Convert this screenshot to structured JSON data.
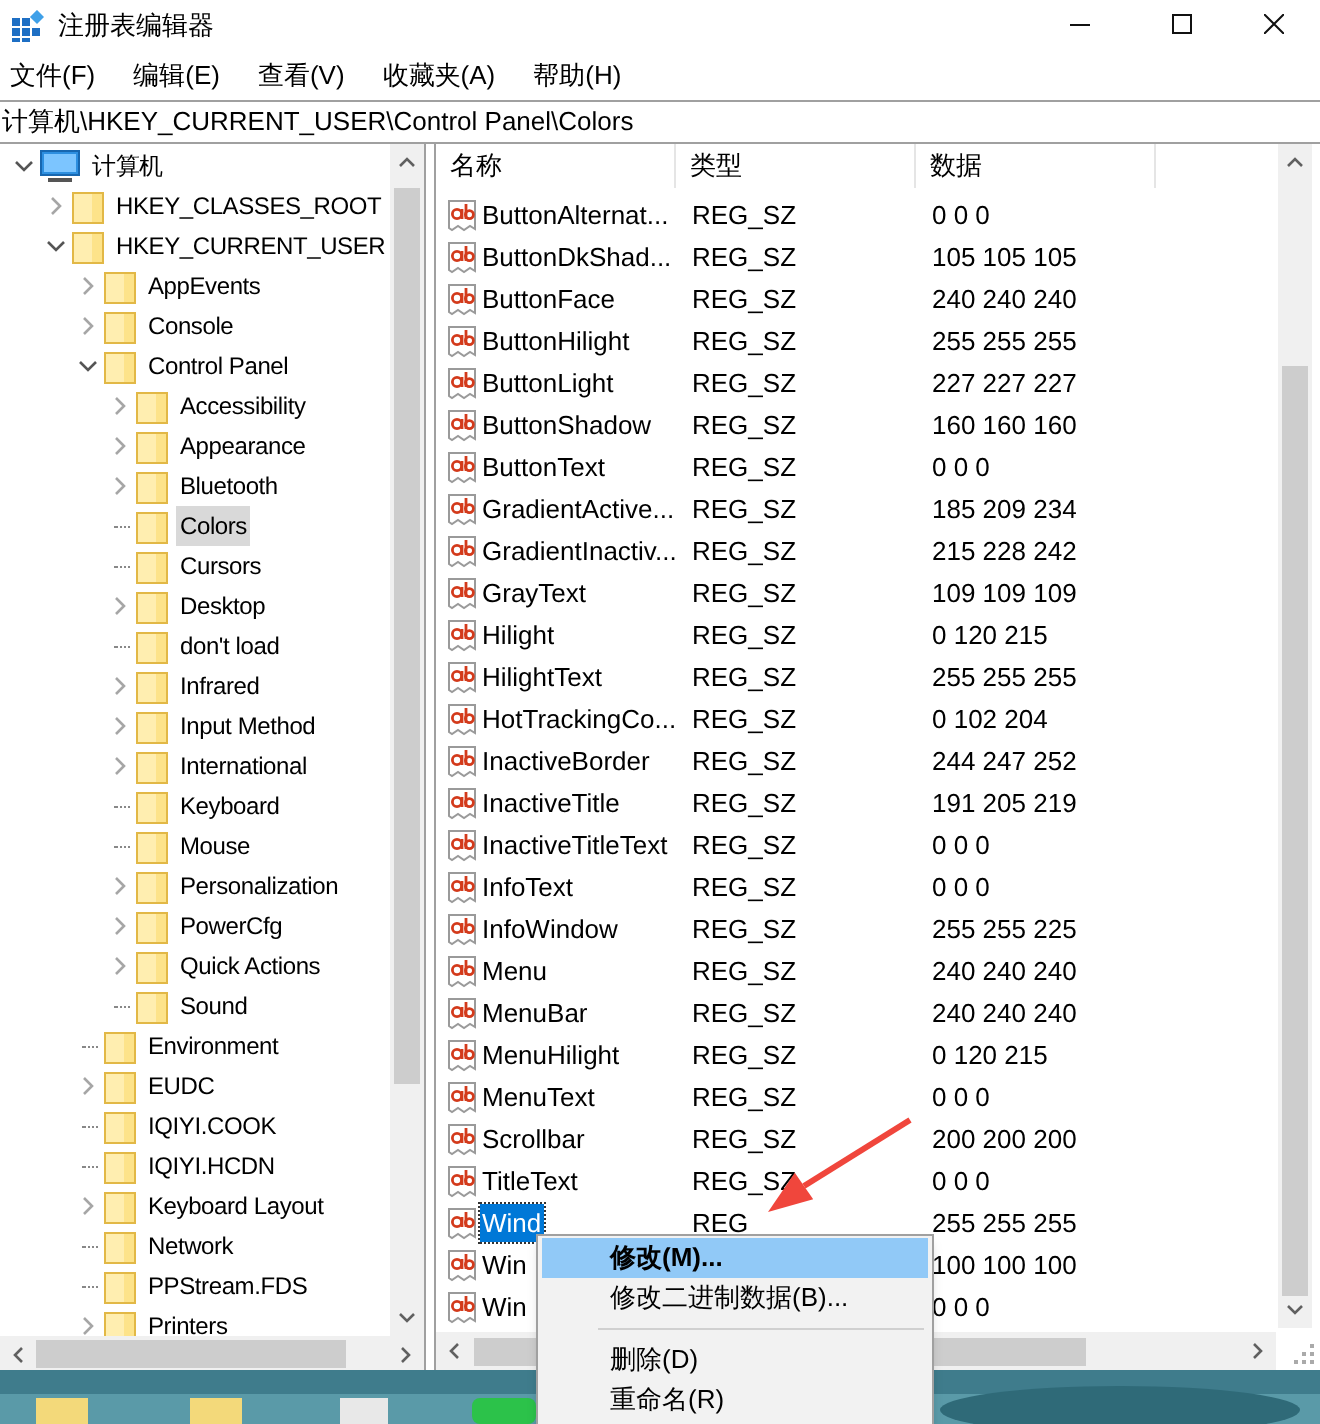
{
  "window": {
    "title": "注册表编辑器"
  },
  "menu_bar": [
    "文件(F)",
    "编辑(E)",
    "查看(V)",
    "收藏夹(A)",
    "帮助(H)"
  ],
  "address_bar": "计算机\\HKEY_CURRENT_USER\\Control Panel\\Colors",
  "tree": [
    {
      "label": "计算机",
      "kind": "computer",
      "has_children": true,
      "expanded": true,
      "selected": false,
      "children": [
        {
          "label": "HKEY_CLASSES_ROOT",
          "has_children": true,
          "expanded": false,
          "selected": false
        },
        {
          "label": "HKEY_CURRENT_USER",
          "has_children": true,
          "expanded": true,
          "selected": false,
          "children": [
            {
              "label": "AppEvents",
              "has_children": true,
              "expanded": false,
              "selected": false
            },
            {
              "label": "Console",
              "has_children": true,
              "expanded": false,
              "selected": false
            },
            {
              "label": "Control Panel",
              "has_children": true,
              "expanded": true,
              "selected": false,
              "children": [
                {
                  "label": "Accessibility",
                  "has_children": true,
                  "expanded": false,
                  "selected": false
                },
                {
                  "label": "Appearance",
                  "has_children": true,
                  "expanded": false,
                  "selected": false
                },
                {
                  "label": "Bluetooth",
                  "has_children": true,
                  "expanded": false,
                  "selected": false
                },
                {
                  "label": "Colors",
                  "has_children": false,
                  "selected": true
                },
                {
                  "label": "Cursors",
                  "has_children": false,
                  "selected": false
                },
                {
                  "label": "Desktop",
                  "has_children": true,
                  "expanded": false,
                  "selected": false
                },
                {
                  "label": "don't load",
                  "has_children": false,
                  "selected": false
                },
                {
                  "label": "Infrared",
                  "has_children": true,
                  "expanded": false,
                  "selected": false
                },
                {
                  "label": "Input Method",
                  "has_children": true,
                  "expanded": false,
                  "selected": false
                },
                {
                  "label": "International",
                  "has_children": true,
                  "expanded": false,
                  "selected": false
                },
                {
                  "label": "Keyboard",
                  "has_children": false,
                  "selected": false
                },
                {
                  "label": "Mouse",
                  "has_children": false,
                  "selected": false
                },
                {
                  "label": "Personalization",
                  "has_children": true,
                  "expanded": false,
                  "selected": false
                },
                {
                  "label": "PowerCfg",
                  "has_children": true,
                  "expanded": false,
                  "selected": false
                },
                {
                  "label": "Quick Actions",
                  "has_children": true,
                  "expanded": false,
                  "selected": false
                },
                {
                  "label": "Sound",
                  "has_children": false,
                  "selected": false
                }
              ]
            },
            {
              "label": "Environment",
              "has_children": false,
              "selected": false
            },
            {
              "label": "EUDC",
              "has_children": true,
              "expanded": false,
              "selected": false
            },
            {
              "label": "IQIYI.COOK",
              "has_children": false,
              "selected": false
            },
            {
              "label": "IQIYI.HCDN",
              "has_children": false,
              "selected": false
            },
            {
              "label": "Keyboard Layout",
              "has_children": true,
              "expanded": false,
              "selected": false
            },
            {
              "label": "Network",
              "has_children": false,
              "selected": false
            },
            {
              "label": "PPStream.FDS",
              "has_children": false,
              "selected": false
            },
            {
              "label": "Printers",
              "has_children": true,
              "expanded": false,
              "selected": false
            }
          ]
        }
      ]
    }
  ],
  "table": {
    "columns": [
      "名称",
      "类型",
      "数据"
    ],
    "rows": [
      {
        "name": "ButtonAlternat...",
        "type": "REG_SZ",
        "data": "0 0 0",
        "selected": false
      },
      {
        "name": "ButtonDkShad...",
        "type": "REG_SZ",
        "data": "105 105 105",
        "selected": false
      },
      {
        "name": "ButtonFace",
        "type": "REG_SZ",
        "data": "240 240 240",
        "selected": false
      },
      {
        "name": "ButtonHilight",
        "type": "REG_SZ",
        "data": "255 255 255",
        "selected": false
      },
      {
        "name": "ButtonLight",
        "type": "REG_SZ",
        "data": "227 227 227",
        "selected": false
      },
      {
        "name": "ButtonShadow",
        "type": "REG_SZ",
        "data": "160 160 160",
        "selected": false
      },
      {
        "name": "ButtonText",
        "type": "REG_SZ",
        "data": "0 0 0",
        "selected": false
      },
      {
        "name": "GradientActive...",
        "type": "REG_SZ",
        "data": "185 209 234",
        "selected": false
      },
      {
        "name": "GradientInactiv...",
        "type": "REG_SZ",
        "data": "215 228 242",
        "selected": false
      },
      {
        "name": "GrayText",
        "type": "REG_SZ",
        "data": "109 109 109",
        "selected": false
      },
      {
        "name": "Hilight",
        "type": "REG_SZ",
        "data": "0 120 215",
        "selected": false
      },
      {
        "name": "HilightText",
        "type": "REG_SZ",
        "data": "255 255 255",
        "selected": false
      },
      {
        "name": "HotTrackingCo...",
        "type": "REG_SZ",
        "data": "0 102 204",
        "selected": false
      },
      {
        "name": "InactiveBorder",
        "type": "REG_SZ",
        "data": "244 247 252",
        "selected": false
      },
      {
        "name": "InactiveTitle",
        "type": "REG_SZ",
        "data": "191 205 219",
        "selected": false
      },
      {
        "name": "InactiveTitleText",
        "type": "REG_SZ",
        "data": "0 0 0",
        "selected": false
      },
      {
        "name": "InfoText",
        "type": "REG_SZ",
        "data": "0 0 0",
        "selected": false
      },
      {
        "name": "InfoWindow",
        "type": "REG_SZ",
        "data": "255 255 225",
        "selected": false
      },
      {
        "name": "Menu",
        "type": "REG_SZ",
        "data": "240 240 240",
        "selected": false
      },
      {
        "name": "MenuBar",
        "type": "REG_SZ",
        "data": "240 240 240",
        "selected": false
      },
      {
        "name": "MenuHilight",
        "type": "REG_SZ",
        "data": "0 120 215",
        "selected": false
      },
      {
        "name": "MenuText",
        "type": "REG_SZ",
        "data": "0 0 0",
        "selected": false
      },
      {
        "name": "Scrollbar",
        "type": "REG_SZ",
        "data": "200 200 200",
        "selected": false
      },
      {
        "name": "TitleText",
        "type": "REG_SZ",
        "data": "0 0 0",
        "selected": false
      },
      {
        "name": "Wind",
        "type": "REG",
        "data": "255 255 255",
        "selected": true
      },
      {
        "name": "Win",
        "data": "100 100 100",
        "selected": false
      },
      {
        "name": "Win",
        "data": "0 0 0",
        "selected": false
      }
    ]
  },
  "context_menu": [
    {
      "kind": "item",
      "label": "修改(M)...",
      "selected": true
    },
    {
      "kind": "item",
      "label": "修改二进制数据(B)...",
      "selected": false
    },
    {
      "kind": "separator"
    },
    {
      "kind": "item",
      "label": "删除(D)",
      "selected": false
    },
    {
      "kind": "item",
      "label": "重命名(R)",
      "selected": false
    }
  ]
}
